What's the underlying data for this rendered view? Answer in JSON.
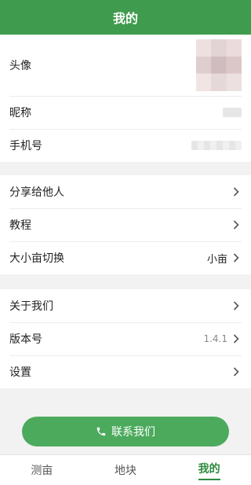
{
  "header": {
    "title": "我的"
  },
  "profile": {
    "avatar_label": "头像",
    "nickname_label": "昵称",
    "phone_label": "手机号"
  },
  "menu1": {
    "share_label": "分享给他人",
    "tutorial_label": "教程",
    "unit_switch_label": "大小亩切换",
    "unit_switch_value": "小亩"
  },
  "menu2": {
    "about_label": "关于我们",
    "version_label": "版本号",
    "version_value": "1.4.1",
    "settings_label": "设置"
  },
  "contact_button": {
    "label": "联系我们"
  },
  "tabs": [
    {
      "label": "测亩"
    },
    {
      "label": "地块"
    },
    {
      "label": "我的"
    }
  ],
  "colors": {
    "primary": "#3f9b4d",
    "button": "#4caa5d",
    "active_tab": "#2e8b3e"
  }
}
